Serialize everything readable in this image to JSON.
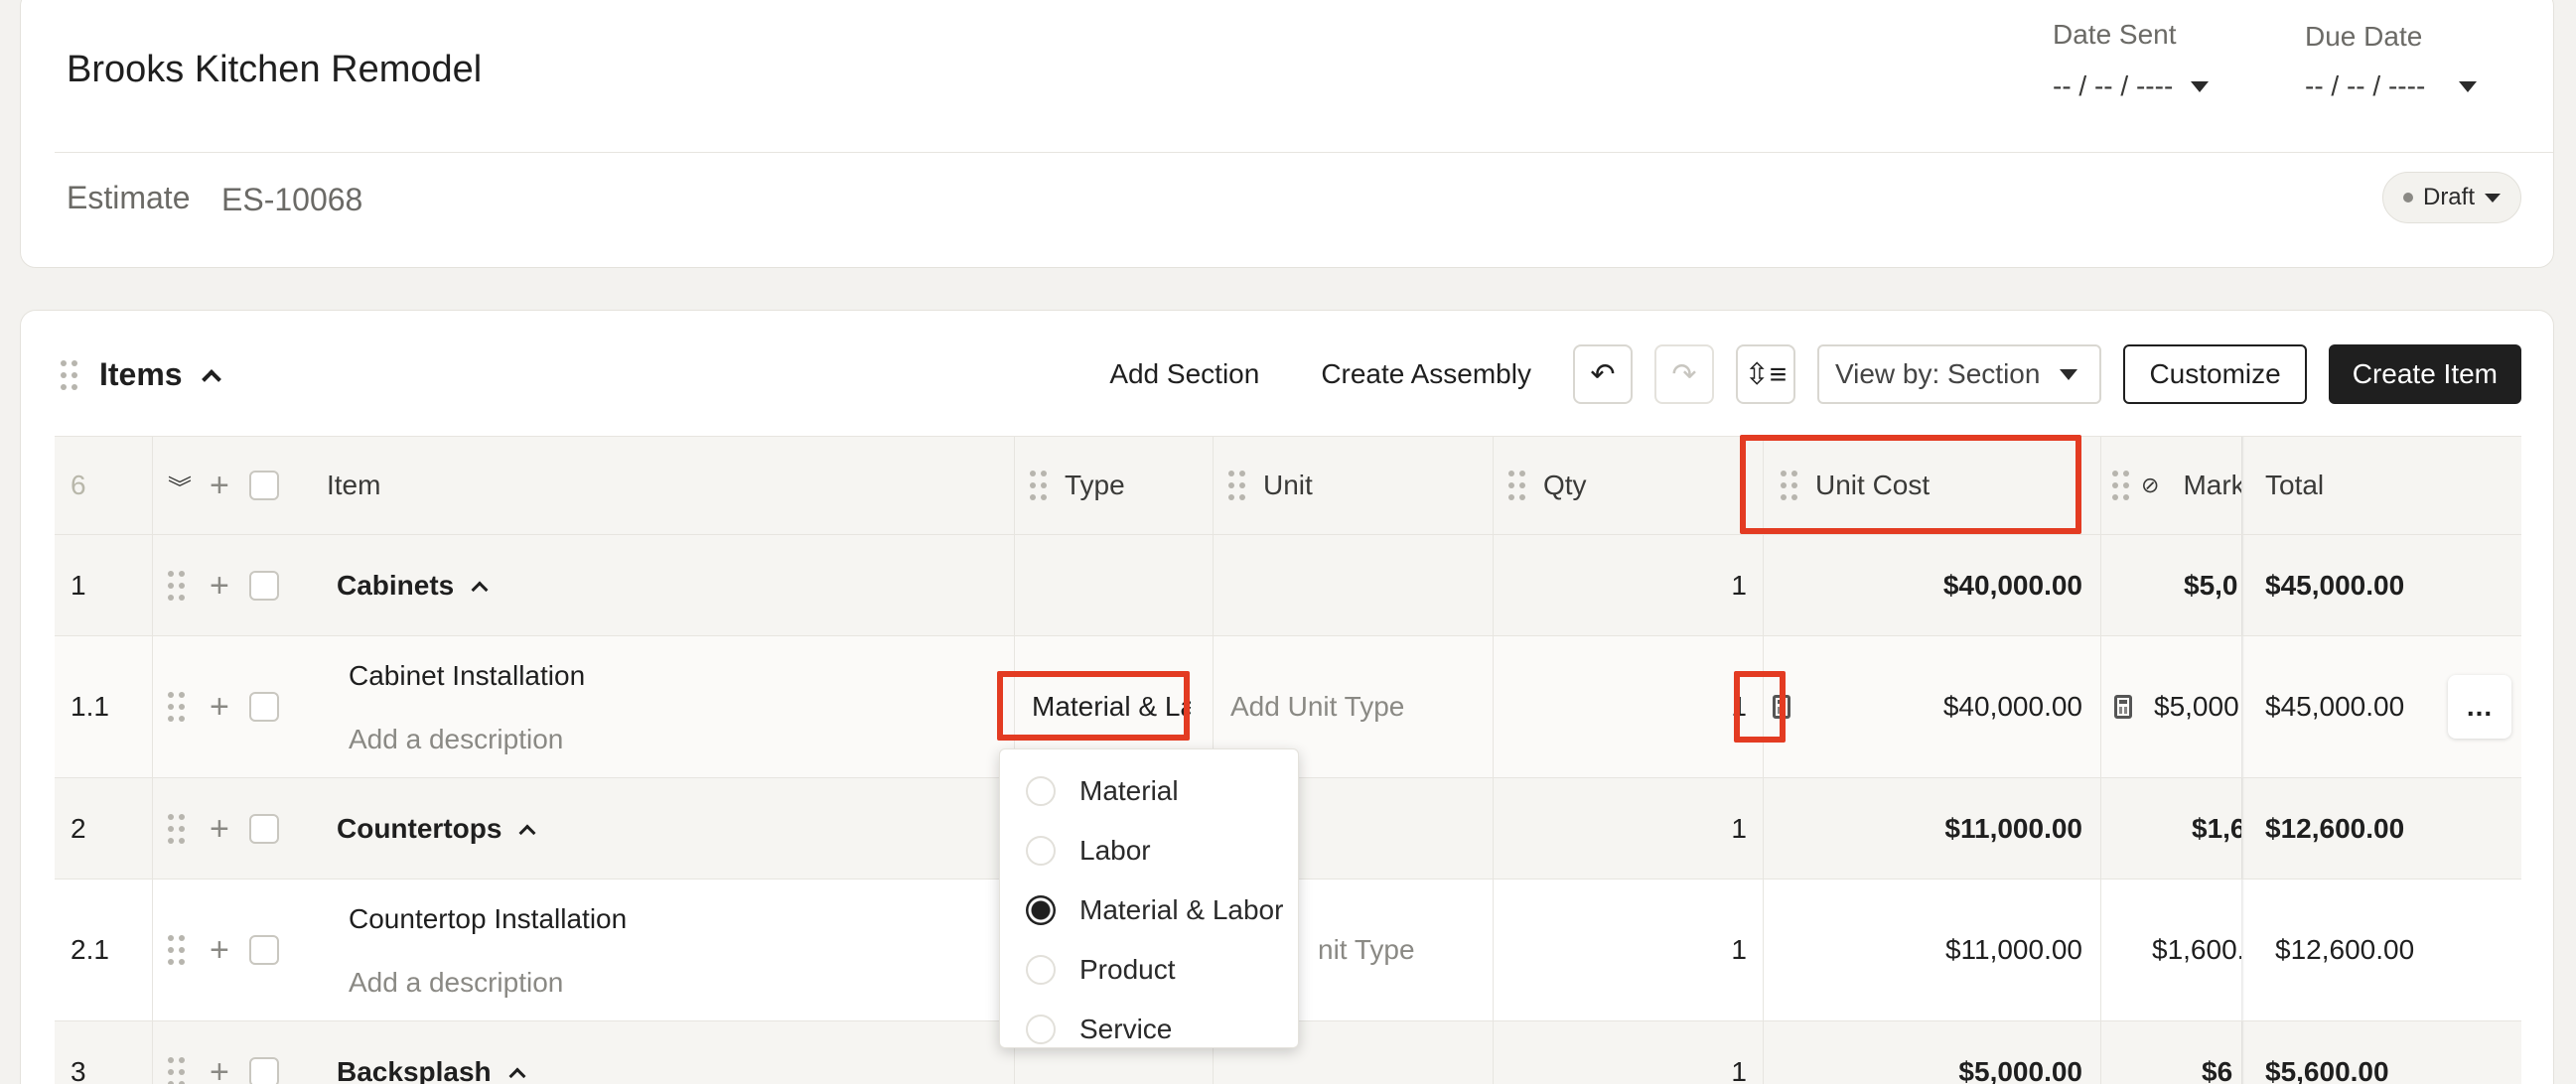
{
  "header": {
    "project_title": "Brooks Kitchen Remodel",
    "date_sent_label": "Date Sent",
    "date_sent_value": "-- / -- / ----",
    "due_date_label": "Due Date",
    "due_date_value": "-- / -- / ----",
    "estimate_label": "Estimate",
    "estimate_number": "ES-10068",
    "status": "Draft"
  },
  "items_panel": {
    "title": "Items",
    "add_section": "Add Section",
    "create_assembly": "Create Assembly",
    "undo_icon": "undo-icon",
    "redo_icon": "redo-icon",
    "line_height_icon": "line-spacing-icon",
    "view_by": "View by: Section",
    "customize": "Customize",
    "create_item": "Create Item"
  },
  "table": {
    "count": "6",
    "columns": {
      "item": "Item",
      "type": "Type",
      "unit": "Unit",
      "qty": "Qty",
      "unit_cost": "Unit Cost",
      "markup": "Mark",
      "total": "Total"
    },
    "rows": [
      {
        "num": "1",
        "kind": "section",
        "name": "Cabinets",
        "qty": "1",
        "unit_cost": "$40,000.00",
        "markup": "$5,0",
        "total": "$45,000.00"
      },
      {
        "num": "1.1",
        "kind": "item",
        "name": "Cabinet Installation",
        "description": "Add a description",
        "type": "Material & La",
        "unit": "Add Unit Type",
        "qty": "1",
        "unit_cost": "$40,000.00",
        "markup": "$5,000",
        "total": "$45,000.00",
        "more": "..."
      },
      {
        "num": "2",
        "kind": "section",
        "name": "Countertops",
        "qty": "1",
        "unit_cost": "$11,000.00",
        "markup": "$1,6",
        "total": "$12,600.00"
      },
      {
        "num": "2.1",
        "kind": "item",
        "name": "Countertop Installation",
        "description": "Add a description",
        "unit": "nit Type",
        "qty": "1",
        "unit_cost": "$11,000.00",
        "markup": "$1,600.",
        "total": "$12,600.00"
      },
      {
        "num": "3",
        "kind": "section",
        "name": "Backsplash",
        "qty": "1",
        "unit_cost": "$5,000.00",
        "markup": "$6",
        "total": "$5,600.00"
      }
    ]
  },
  "type_dropdown": {
    "options": [
      "Material",
      "Labor",
      "Material & Labor",
      "Product",
      "Service"
    ],
    "selected": "Material & Labor"
  },
  "colors": {
    "highlight": "#e33b22",
    "primary_button": "#1f1f1f"
  }
}
